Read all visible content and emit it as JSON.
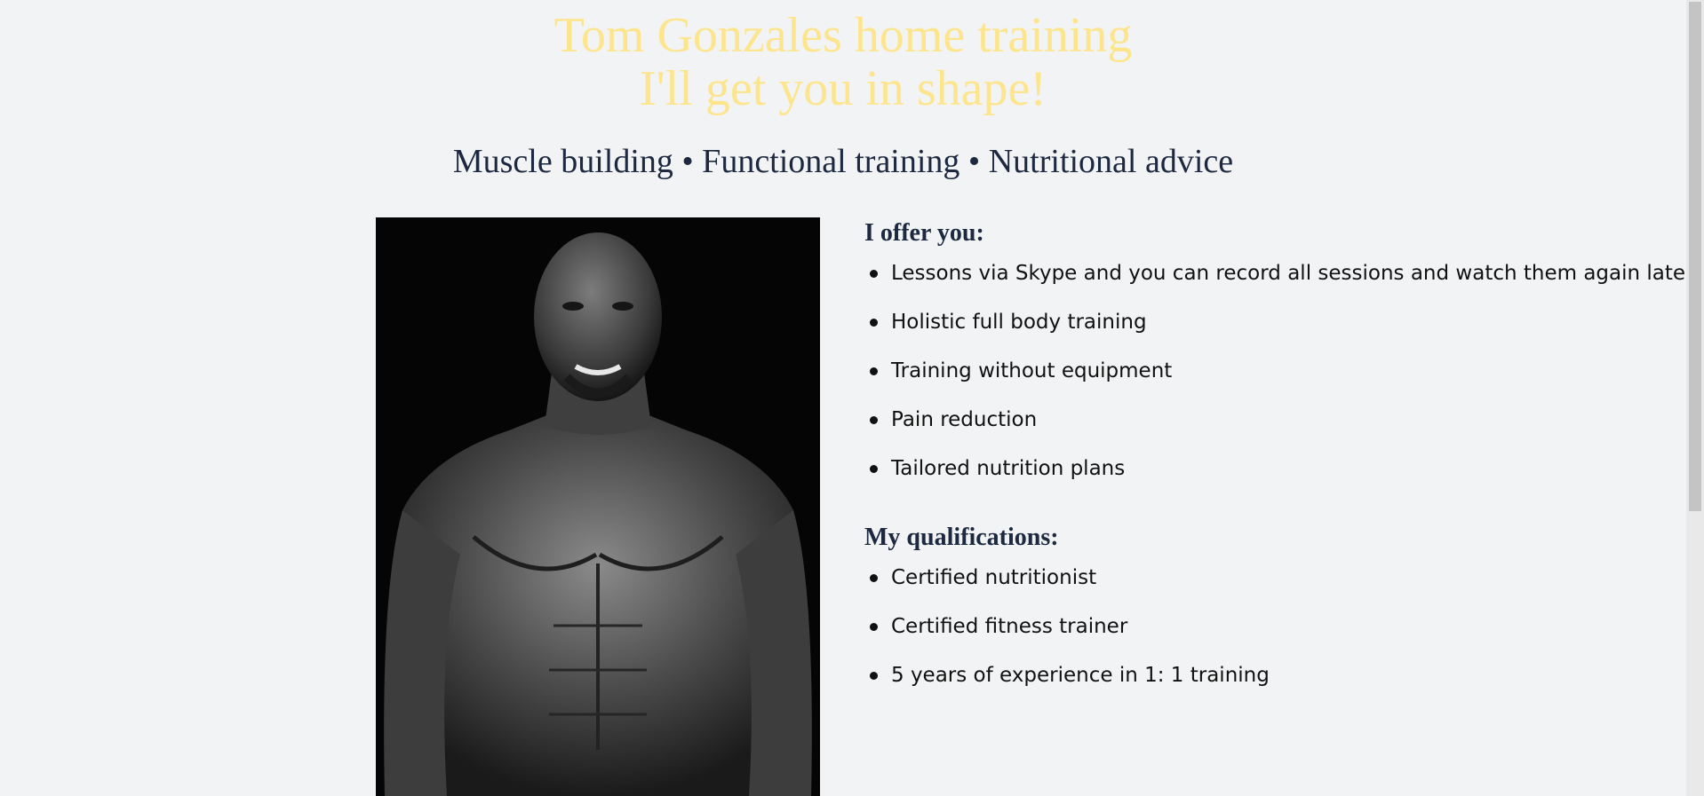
{
  "header": {
    "title_line1": "Tom Gonzales home training",
    "title_line2": "I'll get you in shape!"
  },
  "subtitle": "Muscle building • Functional training • Nutritional advice",
  "offer": {
    "title": "I offer you:",
    "items": [
      "Lessons via Skype and you can record all sessions and watch them again later.",
      "Holistic full body training",
      "Training without equipment",
      "Pain reduction",
      "Tailored nutrition plans"
    ]
  },
  "qualifications": {
    "title": "My qualifications:",
    "items": [
      "Certified nutritionist",
      "Certified fitness trainer",
      "5 years of experience in 1: 1 training"
    ]
  },
  "colors": {
    "title": "#fde58e",
    "subtitle": "#1d2940",
    "background": "#f2f3f4"
  }
}
